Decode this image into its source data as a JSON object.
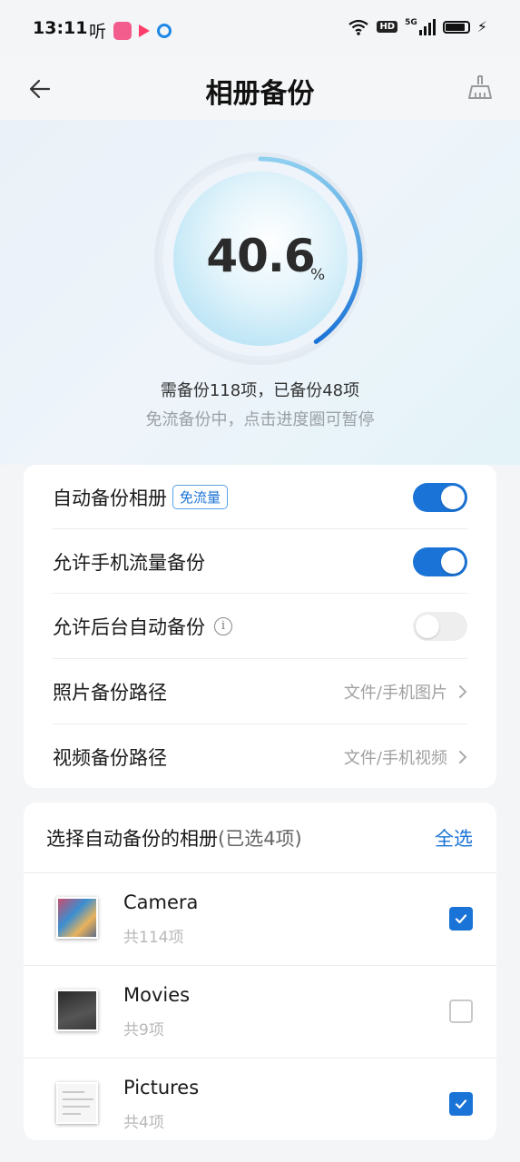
{
  "status_bar": {
    "time": "13:11",
    "ting_glyph": "听",
    "hd_label": "HD",
    "network_label": "5G",
    "battery_percent": 90,
    "icons": [
      "ting-icon",
      "bilibili-icon",
      "play-app-icon",
      "circle-app-icon",
      "wifi-icon",
      "hd-icon",
      "signal-icon",
      "battery-icon",
      "charging-icon"
    ]
  },
  "header": {
    "title": "相册备份",
    "back_icon": "arrow-left-icon",
    "action_icon": "broom-icon"
  },
  "progress": {
    "percent_value": 40.6,
    "percent_text": "40.6",
    "percent_sign": "%",
    "summary": "需备份118项，已备份48项",
    "hint": "免流备份中，点击进度圈可暂停"
  },
  "settings": {
    "auto_backup": {
      "label": "自动备份相册",
      "tag": "免流量",
      "enabled": true
    },
    "mobile_data": {
      "label": "允许手机流量备份",
      "enabled": true
    },
    "background": {
      "label": "允许后台自动备份",
      "info_icon": "info-icon",
      "info_glyph": "i",
      "enabled": false
    },
    "photo_path": {
      "label": "照片备份路径",
      "value": "文件/手机图片"
    },
    "video_path": {
      "label": "视频备份路径",
      "value": "文件/手机视频"
    }
  },
  "albums": {
    "title": "选择自动备份的相册",
    "selected_note": "(已选4项)",
    "select_all": "全选",
    "items": [
      {
        "name": "Camera",
        "count": "共114项",
        "checked": true
      },
      {
        "name": "Movies",
        "count": "共9项",
        "checked": false
      },
      {
        "name": "Pictures",
        "count": "共4项",
        "checked": true
      }
    ]
  },
  "colors": {
    "accent": "#1a73d6",
    "ring_gradient_start": "#8fd0f0",
    "ring_gradient_end": "#1a73d6"
  }
}
